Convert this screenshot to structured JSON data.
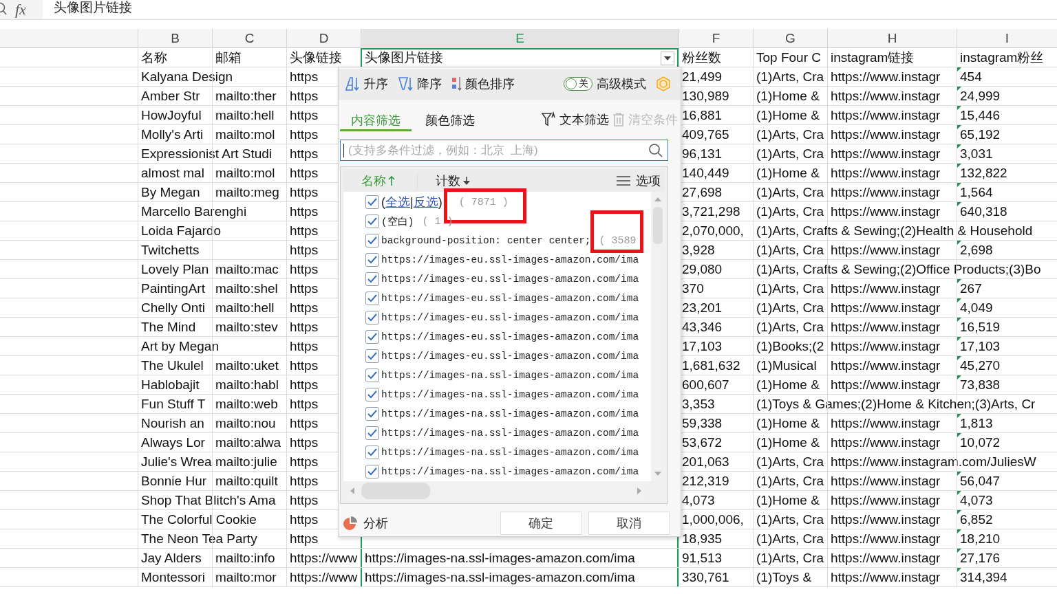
{
  "formula_bar": {
    "label": "fx",
    "value": "头像图片链接"
  },
  "columns": [
    {
      "letter": "B",
      "selected": false,
      "filter": false
    },
    {
      "letter": "C",
      "selected": false,
      "filter": false
    },
    {
      "letter": "D",
      "selected": false,
      "filter": false
    },
    {
      "letter": "E",
      "selected": true,
      "filter": true
    },
    {
      "letter": "F",
      "selected": false,
      "filter": false
    },
    {
      "letter": "G",
      "selected": false,
      "filter": false
    },
    {
      "letter": "H",
      "selected": false,
      "filter": false
    },
    {
      "letter": "I",
      "selected": false,
      "filter": false
    }
  ],
  "header_row": {
    "b": "名称",
    "c": "邮箱",
    "d": "头像链接",
    "e": "头像图片链接",
    "f": "粉丝数",
    "g": "Top Four C",
    "h": "instagram链接",
    "i": "instagram粉丝"
  },
  "rows": [
    {
      "b": "Kalyana Design",
      "d": "https",
      "f": "21,499",
      "g": "(1)Arts, Cra",
      "h": "https://www.instagr",
      "i": "454",
      "i_flag": true
    },
    {
      "b": "Amber Str",
      "c": "mailto:ther",
      "d": "https",
      "f": "130,989",
      "g": "(1)Home &",
      "h": "https://www.instagr",
      "i": "24,999",
      "i_flag": true
    },
    {
      "b": "HowJoyful",
      "c": "mailto:hell",
      "d": "https",
      "f": "16,881",
      "g": "(1)Home &",
      "h": "https://www.instagr",
      "i": "15,446",
      "i_flag": true
    },
    {
      "b": "Molly's Arti",
      "c": "mailto:mol",
      "d": "https",
      "f": "409,765",
      "g": "(1)Arts, Cra",
      "h": "https://www.instagr",
      "i": "65,192",
      "i_flag": true
    },
    {
      "b": "Expressionist Art Studi",
      "d": "https",
      "f": "96,131",
      "g": "(1)Arts, Cra",
      "h": "https://www.instagr",
      "i": "3,031",
      "i_flag": true
    },
    {
      "b": "almost mal",
      "c": "mailto:mol",
      "d": "https",
      "f": "140,449",
      "g": "(1)Home &",
      "h": "https://www.instagr",
      "i": "132,822",
      "i_flag": true
    },
    {
      "b": "By Megan",
      "c": "mailto:meg",
      "d": "https",
      "f": "27,698",
      "g": "(1)Arts, Cra",
      "h": "https://www.instagr",
      "i": "1,564",
      "i_flag": true
    },
    {
      "b": "Marcello Barenghi",
      "d": "https",
      "f": "3,721,298",
      "g": "(1)Arts, Cra",
      "h": "https://www.instagr",
      "i": "640,318",
      "i_flag": true
    },
    {
      "b": "Loida Fajardo",
      "d": "https",
      "f": "2,070,000,",
      "g": "(1)Arts, Crafts & Sewing;(2)Health & Household"
    },
    {
      "b": "Twitchetts",
      "d": "https",
      "f": "3,928",
      "g": "(1)Arts, Cra",
      "h": "https://www.instagr",
      "i": "2,698",
      "i_flag": true
    },
    {
      "b": "Lovely Plan",
      "c": "mailto:mac",
      "d": "https",
      "f": "29,080",
      "g": "(1)Arts, Crafts & Sewing;(2)Office Products;(3)Bo"
    },
    {
      "b": "PaintingArt",
      "c": "mailto:shel",
      "d": "https",
      "f": "370",
      "g": "(1)Arts, Cra",
      "h": "https://www.instagr",
      "i": "267",
      "i_flag": true
    },
    {
      "b": "Chelly Onti",
      "c": "mailto:hell",
      "d": "https",
      "f": "23,201",
      "g": "(1)Arts, Cra",
      "h": "https://www.instagr",
      "i": "4,049",
      "i_flag": true
    },
    {
      "b": "The Mind",
      "c": "mailto:stev",
      "d": "https",
      "f": "43,346",
      "g": "(1)Arts, Cra",
      "h": "https://www.instagr",
      "i": "16,519",
      "i_flag": true
    },
    {
      "b": "Art by Megan",
      "d": "https",
      "f": "17,103",
      "g": "(1)Books;(2",
      "h": "https://www.instagr",
      "i": "17,103",
      "i_flag": true
    },
    {
      "b": "The Ukulel",
      "c": "mailto:uket",
      "d": "https",
      "f": "1,681,632",
      "g": "(1)Musical",
      "h": "https://www.instagr",
      "i": "45,270",
      "i_flag": true
    },
    {
      "b": "Hablobajit",
      "c": "mailto:habl",
      "d": "https",
      "f": "600,607",
      "g": "(1)Home &",
      "h": "https://www.instagr",
      "i": "73,838",
      "i_flag": true
    },
    {
      "b": "Fun Stuff T",
      "c": "mailto:web",
      "d": "https",
      "f": "3,353",
      "g": "(1)Toys & Games;(2)Home & Kitchen;(3)Arts, Cr"
    },
    {
      "b": "Nourish an",
      "c": "mailto:nou",
      "d": "https",
      "f": "59,338",
      "g": "(1)Home &",
      "h": "https://www.instagr",
      "i": "1,813",
      "i_flag": true
    },
    {
      "b": "Always Lor",
      "c": "mailto:alwa",
      "d": "https",
      "f": "53,672",
      "g": "(1)Home &",
      "h": "https://www.instagr",
      "i": "10,072",
      "i_flag": true
    },
    {
      "b": "Julie's Wrea",
      "c": "mailto:julie",
      "d": "https",
      "f": "201,063",
      "g": "(1)Arts, Cra",
      "h": "https://www.instagram.com/JuliesW"
    },
    {
      "b": "Bonnie Hur",
      "c": "mailto:quilt",
      "d": "https",
      "f": "212,319",
      "g": "(1)Arts, Cra",
      "h": "https://www.instagr",
      "i": "56,047",
      "i_flag": true
    },
    {
      "b": "Shop That Blitch's Ama",
      "d": "https",
      "f": "4,073",
      "g": "(1)Home &",
      "h": "https://www.instagr",
      "i": "4,073",
      "i_flag": true
    },
    {
      "b": "The Colorful Cookie",
      "d": "https",
      "f": "1,000,006,",
      "g": "(1)Arts, Cra",
      "h": "https://www.instagr",
      "i": "6,852",
      "i_flag": true
    },
    {
      "b": "The Neon Tea Party",
      "d": "https",
      "f": "18,935",
      "g": "(1)Arts, Cra",
      "h": "https://www.instagr",
      "i": "18,210",
      "i_flag": true
    },
    {
      "b": "Jay Alders",
      "c": "mailto:info",
      "d": "https://www",
      "e": "https://images-na.ssl-images-amazon.com/ima",
      "f": "91,513",
      "g": "(1)Arts, Cra",
      "h": "https://www.instagr",
      "i": "27,176",
      "i_flag": true
    },
    {
      "b": "Montessori",
      "c": "mailto:mor",
      "d": "https://www",
      "e": "https://images-na.ssl-images-amazon.com/ima",
      "f": "330,761",
      "g": "(1)Toys &",
      "h": "https://www.instagr",
      "i": "314,394",
      "i_flag": true
    }
  ],
  "filter_popup": {
    "toolbar": [
      {
        "kind": "asc",
        "label": "升序"
      },
      {
        "kind": "desc",
        "label": "降序"
      },
      {
        "kind": "color",
        "label": "颜色排序"
      }
    ],
    "advanced_toggle": {
      "on": false,
      "state_label": "关",
      "label": "高级模式"
    },
    "tabs": [
      {
        "label": "内容筛选",
        "selected": true
      },
      {
        "label": "颜色筛选",
        "selected": false
      }
    ],
    "text_filter": "文本筛选",
    "clear": {
      "label": "清空条件",
      "disabled": true
    },
    "search": {
      "placeholder": "(支持多条件过滤，例如：北京  上海)"
    },
    "list_header": {
      "name": "名称",
      "count": "计数",
      "options": "选项"
    },
    "select_all": {
      "prefix": "(",
      "links": [
        "全选",
        "反选"
      ],
      "separator": "|",
      "suffix": ")",
      "count": "( 7871 )",
      "checked": true,
      "highlighted": true
    },
    "items": [
      {
        "label": "(空白)",
        "count": "( 1 )",
        "checked": true,
        "highlighted": false
      },
      {
        "label": "background-position: center center;",
        "count": "( 3589",
        "checked": true,
        "highlighted": true
      },
      {
        "label": "https://images-eu.ssl-images-amazon.com/ima",
        "checked": true,
        "highlighted": false
      },
      {
        "label": "https://images-eu.ssl-images-amazon.com/ima",
        "checked": true,
        "highlighted": false
      },
      {
        "label": "https://images-eu.ssl-images-amazon.com/ima",
        "checked": true,
        "highlighted": false
      },
      {
        "label": "https://images-eu.ssl-images-amazon.com/ima",
        "checked": true,
        "highlighted": false
      },
      {
        "label": "https://images-eu.ssl-images-amazon.com/ima",
        "checked": true,
        "highlighted": false
      },
      {
        "label": "https://images-eu.ssl-images-amazon.com/ima",
        "checked": true,
        "highlighted": false
      },
      {
        "label": "https://images-na.ssl-images-amazon.com/ima",
        "checked": true,
        "highlighted": false
      },
      {
        "label": "https://images-na.ssl-images-amazon.com/ima",
        "checked": true,
        "highlighted": false
      },
      {
        "label": "https://images-na.ssl-images-amazon.com/ima",
        "checked": true,
        "highlighted": false
      },
      {
        "label": "https://images-na.ssl-images-amazon.com/ima",
        "checked": true,
        "highlighted": false
      },
      {
        "label": "https://images-na.ssl-images-amazon.com/ima",
        "checked": true,
        "highlighted": false
      },
      {
        "label": "https://images-na.ssl-images-amazon.com/ima",
        "checked": true,
        "highlighted": false
      }
    ],
    "analyze": "分析",
    "buttons": [
      "确定",
      "取消"
    ]
  }
}
